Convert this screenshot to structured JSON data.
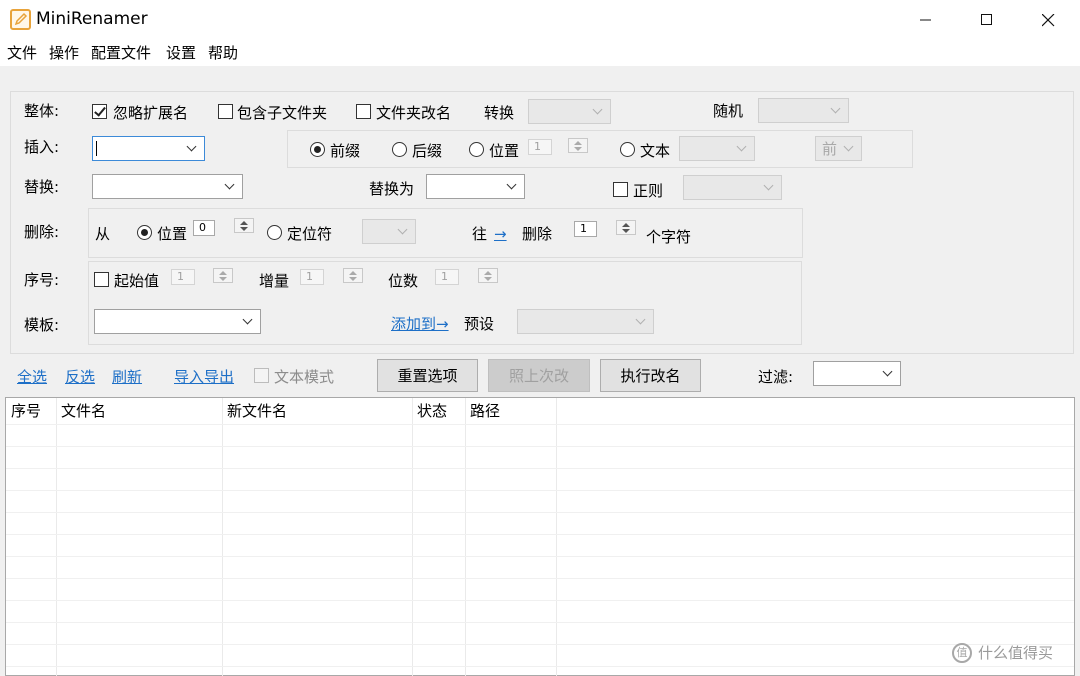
{
  "window": {
    "title": "MiniRenamer"
  },
  "menu": [
    "文件",
    "操作",
    "配置文件",
    "设置",
    "帮助"
  ],
  "overall": {
    "label": "整体:",
    "ignore_ext": "忽略扩展名",
    "include_subfolders": "包含子文件夹",
    "rename_folders": "文件夹改名",
    "convert": "转换",
    "random": "随机"
  },
  "insert": {
    "label": "插入:",
    "prefix": "前缀",
    "suffix": "后缀",
    "position": "位置",
    "position_value": "1",
    "text": "文本",
    "front": "前"
  },
  "replace": {
    "label": "替换:",
    "replace_with": "替换为",
    "regex": "正则"
  },
  "delete": {
    "label": "删除:",
    "from": "从",
    "position": "位置",
    "position_value": "0",
    "locator": "定位符",
    "toward": "往",
    "arrow": "→",
    "delete": "删除",
    "count_value": "1",
    "chars": "个字符"
  },
  "sequence": {
    "label": "序号:",
    "start": "起始值",
    "start_value": "1",
    "increment": "增量",
    "increment_value": "1",
    "digits": "位数",
    "digits_value": "1"
  },
  "template": {
    "label": "模板:",
    "add_to": "添加到→",
    "preset": "预设"
  },
  "actions": {
    "select_all": "全选",
    "invert": "反选",
    "refresh": "刷新",
    "import_export": "导入导出",
    "text_mode": "文本模式",
    "reset": "重置选项",
    "repeat_last": "照上次改",
    "execute": "执行改名",
    "filter": "过滤:"
  },
  "table": {
    "columns": [
      "序号",
      "文件名",
      "新文件名",
      "状态",
      "路径"
    ]
  },
  "watermark": "什么值得买"
}
